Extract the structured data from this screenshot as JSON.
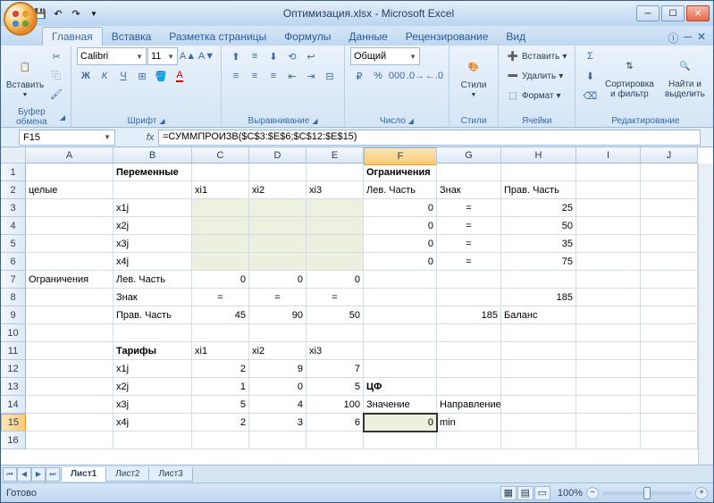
{
  "title": "Оптимизация.xlsx - Microsoft Excel",
  "tabs": [
    "Главная",
    "Вставка",
    "Разметка страницы",
    "Формулы",
    "Данные",
    "Рецензирование",
    "Вид"
  ],
  "active_tab": 0,
  "ribbon": {
    "clipboard": {
      "label": "Буфер обмена",
      "paste": "Вставить"
    },
    "font": {
      "label": "Шрифт",
      "name": "Calibri",
      "size": "11"
    },
    "align": {
      "label": "Выравнивание"
    },
    "number": {
      "label": "Число",
      "format": "Общий"
    },
    "styles": {
      "label": "Стили",
      "btn": "Стили"
    },
    "cells": {
      "label": "Ячейки",
      "insert": "Вставить",
      "delete": "Удалить",
      "format": "Формат"
    },
    "editing": {
      "label": "Редактирование",
      "sort": "Сортировка и фильтр",
      "find": "Найти и выделить"
    }
  },
  "namebox": "F15",
  "formula": "=СУММПРОИЗВ($C$3:$E$6;$C$12:$E$15)",
  "columns": [
    "A",
    "B",
    "C",
    "D",
    "E",
    "F",
    "G",
    "H",
    "I",
    "J"
  ],
  "rows": 16,
  "selected_cell": {
    "row": 15,
    "col": "F"
  },
  "grid": {
    "r1": {
      "B": {
        "t": "Переменные",
        "b": true
      },
      "F": {
        "t": "Ограничения",
        "b": true
      }
    },
    "r2": {
      "A": {
        "t": "целые"
      },
      "C": {
        "t": "xi1"
      },
      "D": {
        "t": "xi2"
      },
      "E": {
        "t": "xi3"
      },
      "F": {
        "t": "Лев. Часть"
      },
      "G": {
        "t": "Знак"
      },
      "H": {
        "t": "Прав. Часть"
      }
    },
    "r3": {
      "B": {
        "t": "x1j"
      },
      "F": {
        "t": "0",
        "r": true
      },
      "G": {
        "t": "=",
        "c": true
      },
      "H": {
        "t": "25",
        "r": true
      }
    },
    "r4": {
      "B": {
        "t": "x2j"
      },
      "F": {
        "t": "0",
        "r": true
      },
      "G": {
        "t": "=",
        "c": true
      },
      "H": {
        "t": "50",
        "r": true
      }
    },
    "r5": {
      "B": {
        "t": "x3j"
      },
      "F": {
        "t": "0",
        "r": true
      },
      "G": {
        "t": "=",
        "c": true
      },
      "H": {
        "t": "35",
        "r": true
      }
    },
    "r6": {
      "B": {
        "t": "x4j"
      },
      "F": {
        "t": "0",
        "r": true
      },
      "G": {
        "t": "=",
        "c": true
      },
      "H": {
        "t": "75",
        "r": true
      }
    },
    "r7": {
      "A": {
        "t": "Ограничения"
      },
      "B": {
        "t": "Лев. Часть"
      },
      "C": {
        "t": "0",
        "r": true
      },
      "D": {
        "t": "0",
        "r": true
      },
      "E": {
        "t": "0",
        "r": true
      }
    },
    "r8": {
      "B": {
        "t": "Знак"
      },
      "C": {
        "t": "=",
        "c": true
      },
      "D": {
        "t": "=",
        "c": true
      },
      "E": {
        "t": "=",
        "c": true
      },
      "H": {
        "t": "185",
        "r": true
      }
    },
    "r9": {
      "B": {
        "t": "Прав. Часть"
      },
      "C": {
        "t": "45",
        "r": true
      },
      "D": {
        "t": "90",
        "r": true
      },
      "E": {
        "t": "50",
        "r": true
      },
      "G": {
        "t": "185",
        "r": true
      },
      "H": {
        "t": "Баланс"
      }
    },
    "r11": {
      "B": {
        "t": "Тарифы",
        "b": true
      },
      "C": {
        "t": "xi1"
      },
      "D": {
        "t": "xi2"
      },
      "E": {
        "t": "xi3"
      }
    },
    "r12": {
      "B": {
        "t": "x1j"
      },
      "C": {
        "t": "2",
        "r": true
      },
      "D": {
        "t": "9",
        "r": true
      },
      "E": {
        "t": "7",
        "r": true
      }
    },
    "r13": {
      "B": {
        "t": "x2j"
      },
      "C": {
        "t": "1",
        "r": true
      },
      "D": {
        "t": "0",
        "r": true
      },
      "E": {
        "t": "5",
        "r": true
      },
      "F": {
        "t": "ЦФ",
        "b": true
      }
    },
    "r14": {
      "B": {
        "t": "x3j"
      },
      "C": {
        "t": "5",
        "r": true
      },
      "D": {
        "t": "4",
        "r": true
      },
      "E": {
        "t": "100",
        "r": true
      },
      "F": {
        "t": "Значение"
      },
      "G": {
        "t": "Направление"
      }
    },
    "r15": {
      "B": {
        "t": "x4j"
      },
      "C": {
        "t": "2",
        "r": true
      },
      "D": {
        "t": "3",
        "r": true
      },
      "E": {
        "t": "6",
        "r": true
      },
      "F": {
        "t": "0",
        "r": true,
        "active": true
      },
      "G": {
        "t": "min"
      }
    }
  },
  "fill_range": {
    "rows": [
      3,
      4,
      5,
      6
    ],
    "cols": [
      "C",
      "D",
      "E"
    ]
  },
  "sheets": [
    "Лист1",
    "Лист2",
    "Лист3"
  ],
  "active_sheet": 0,
  "status": "Готово",
  "zoom": "100%"
}
